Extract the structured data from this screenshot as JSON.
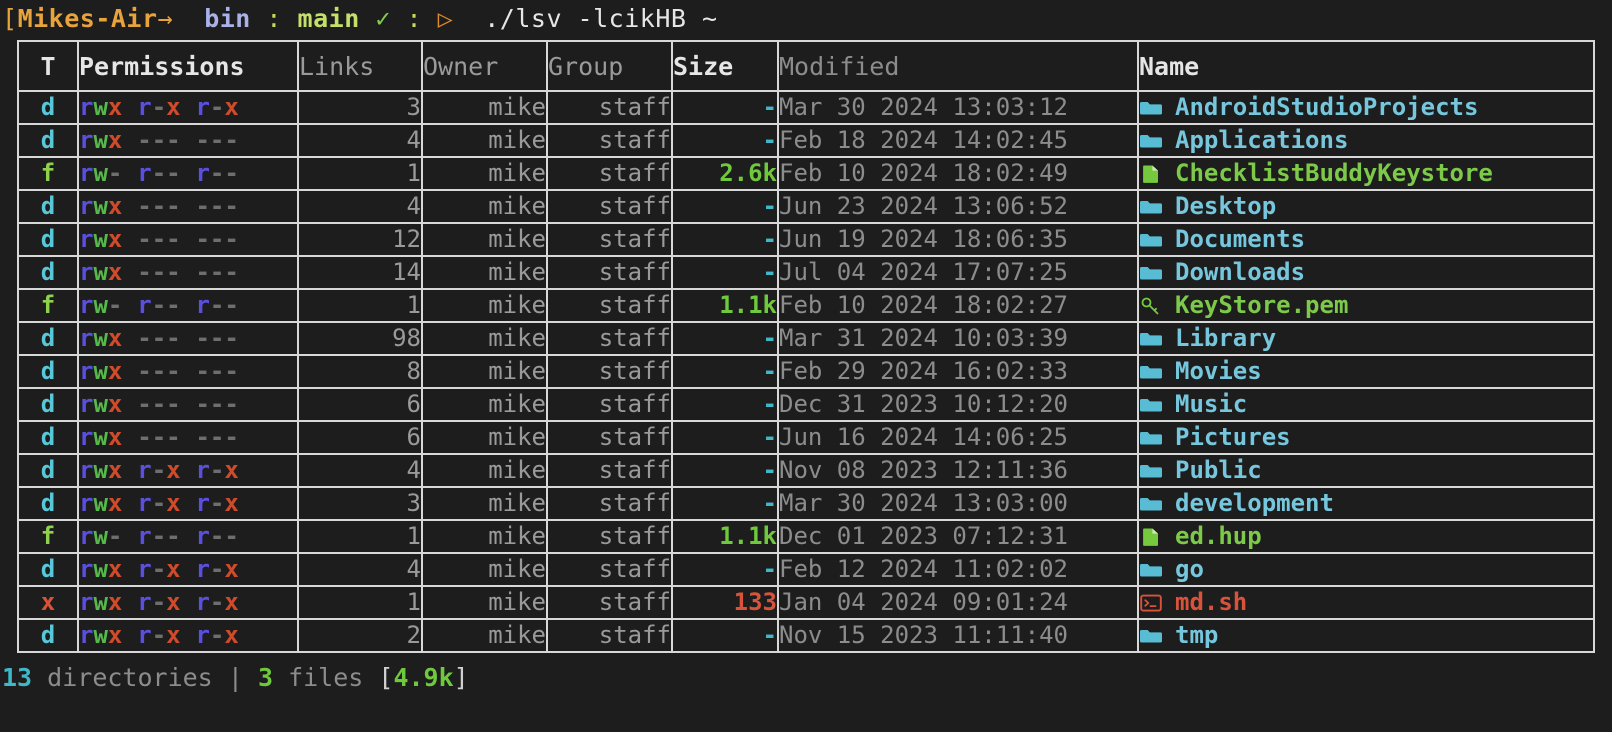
{
  "prompt": {
    "open_bracket": "[",
    "host": "Mikes-Air",
    "arrow": "→",
    "dir": "bin",
    "sep1": ":",
    "branch": "main",
    "check": "✓",
    "sep2": ":",
    "triangle": "▷",
    "command": "./lsv -lcikHB ~"
  },
  "table": {
    "headers": [
      "T",
      "Permissions",
      "Links",
      "Owner",
      "Group",
      "Size",
      "Modified",
      "Name"
    ],
    "rows": [
      {
        "type": "d",
        "perm": "rwx r-x r-x",
        "links": "3",
        "owner": "mike",
        "group": "staff",
        "size": "-",
        "size_kind": "dash",
        "modified": "Mar 30 2024 13:03:12",
        "name": "AndroidStudioProjects",
        "icon": "folder-icon",
        "name_kind": "dir"
      },
      {
        "type": "d",
        "perm": "rwx --- ---",
        "links": "4",
        "owner": "mike",
        "group": "staff",
        "size": "-",
        "size_kind": "dash",
        "modified": "Feb 18 2024 14:02:45",
        "name": "Applications",
        "icon": "folder-icon",
        "name_kind": "dir"
      },
      {
        "type": "f",
        "perm": "rw- r-- r--",
        "links": "1",
        "owner": "mike",
        "group": "staff",
        "size": "2.6k",
        "size_kind": "file",
        "modified": "Feb 10 2024 18:02:49",
        "name": "ChecklistBuddyKeystore",
        "icon": "document-icon",
        "name_kind": "file"
      },
      {
        "type": "d",
        "perm": "rwx --- ---",
        "links": "4",
        "owner": "mike",
        "group": "staff",
        "size": "-",
        "size_kind": "dash",
        "modified": "Jun 23 2024 13:06:52",
        "name": "Desktop",
        "icon": "folder-icon",
        "name_kind": "dir"
      },
      {
        "type": "d",
        "perm": "rwx --- ---",
        "links": "12",
        "owner": "mike",
        "group": "staff",
        "size": "-",
        "size_kind": "dash",
        "modified": "Jun 19 2024 18:06:35",
        "name": "Documents",
        "icon": "folder-icon",
        "name_kind": "dir"
      },
      {
        "type": "d",
        "perm": "rwx --- ---",
        "links": "14",
        "owner": "mike",
        "group": "staff",
        "size": "-",
        "size_kind": "dash",
        "modified": "Jul 04 2024 17:07:25",
        "name": "Downloads",
        "icon": "folder-icon",
        "name_kind": "dir"
      },
      {
        "type": "f",
        "perm": "rw- r-- r--",
        "links": "1",
        "owner": "mike",
        "group": "staff",
        "size": "1.1k",
        "size_kind": "file",
        "modified": "Feb 10 2024 18:02:27",
        "name": "KeyStore.pem",
        "icon": "key-icon",
        "name_kind": "file"
      },
      {
        "type": "d",
        "perm": "rwx --- ---",
        "links": "98",
        "owner": "mike",
        "group": "staff",
        "size": "-",
        "size_kind": "dash",
        "modified": "Mar 31 2024 10:03:39",
        "name": "Library",
        "icon": "folder-icon",
        "name_kind": "dir"
      },
      {
        "type": "d",
        "perm": "rwx --- ---",
        "links": "8",
        "owner": "mike",
        "group": "staff",
        "size": "-",
        "size_kind": "dash",
        "modified": "Feb 29 2024 16:02:33",
        "name": "Movies",
        "icon": "folder-icon",
        "name_kind": "dir"
      },
      {
        "type": "d",
        "perm": "rwx --- ---",
        "links": "6",
        "owner": "mike",
        "group": "staff",
        "size": "-",
        "size_kind": "dash",
        "modified": "Dec 31 2023 10:12:20",
        "name": "Music",
        "icon": "folder-icon",
        "name_kind": "dir"
      },
      {
        "type": "d",
        "perm": "rwx --- ---",
        "links": "6",
        "owner": "mike",
        "group": "staff",
        "size": "-",
        "size_kind": "dash",
        "modified": "Jun 16 2024 14:06:25",
        "name": "Pictures",
        "icon": "folder-icon",
        "name_kind": "dir"
      },
      {
        "type": "d",
        "perm": "rwx r-x r-x",
        "links": "4",
        "owner": "mike",
        "group": "staff",
        "size": "-",
        "size_kind": "dash",
        "modified": "Nov 08 2023 12:11:36",
        "name": "Public",
        "icon": "folder-icon",
        "name_kind": "dir"
      },
      {
        "type": "d",
        "perm": "rwx r-x r-x",
        "links": "3",
        "owner": "mike",
        "group": "staff",
        "size": "-",
        "size_kind": "dash",
        "modified": "Mar 30 2024 13:03:00",
        "name": "development",
        "icon": "folder-icon",
        "name_kind": "dir"
      },
      {
        "type": "f",
        "perm": "rw- r-- r--",
        "links": "1",
        "owner": "mike",
        "group": "staff",
        "size": "1.1k",
        "size_kind": "file",
        "modified": "Dec 01 2023 07:12:31",
        "name": "ed.hup",
        "icon": "document-icon",
        "name_kind": "file"
      },
      {
        "type": "d",
        "perm": "rwx r-x r-x",
        "links": "4",
        "owner": "mike",
        "group": "staff",
        "size": "-",
        "size_kind": "dash",
        "modified": "Feb 12 2024 11:02:02",
        "name": "go",
        "icon": "folder-icon",
        "name_kind": "dir"
      },
      {
        "type": "x",
        "perm": "rwx r-x r-x",
        "links": "1",
        "owner": "mike",
        "group": "staff",
        "size": "133",
        "size_kind": "exec",
        "modified": "Jan 04 2024 09:01:24",
        "name": "md.sh",
        "icon": "shell-icon",
        "name_kind": "exec"
      },
      {
        "type": "d",
        "perm": "rwx r-x r-x",
        "links": "2",
        "owner": "mike",
        "group": "staff",
        "size": "-",
        "size_kind": "dash",
        "modified": "Nov 15 2023 11:11:40",
        "name": "tmp",
        "icon": "folder-icon",
        "name_kind": "dir"
      }
    ]
  },
  "summary": {
    "dir_count": "13",
    "dir_word": "directories",
    "pipe": "|",
    "file_count": "3",
    "file_word": "files",
    "open_bracket": "[",
    "total_size": "4.9k",
    "close_bracket": "]"
  },
  "colors": {
    "background": "#1d1d1d",
    "border": "#d8d8d8",
    "dir": "#76c7dd",
    "file": "#7dc94a",
    "exec": "#d9533a",
    "muted": "#8c8c8c",
    "perm_read": "#5b4fe0",
    "perm_write": "#56b94a",
    "perm_exec": "#cf4b2a",
    "perm_none": "#6e6e6e"
  }
}
